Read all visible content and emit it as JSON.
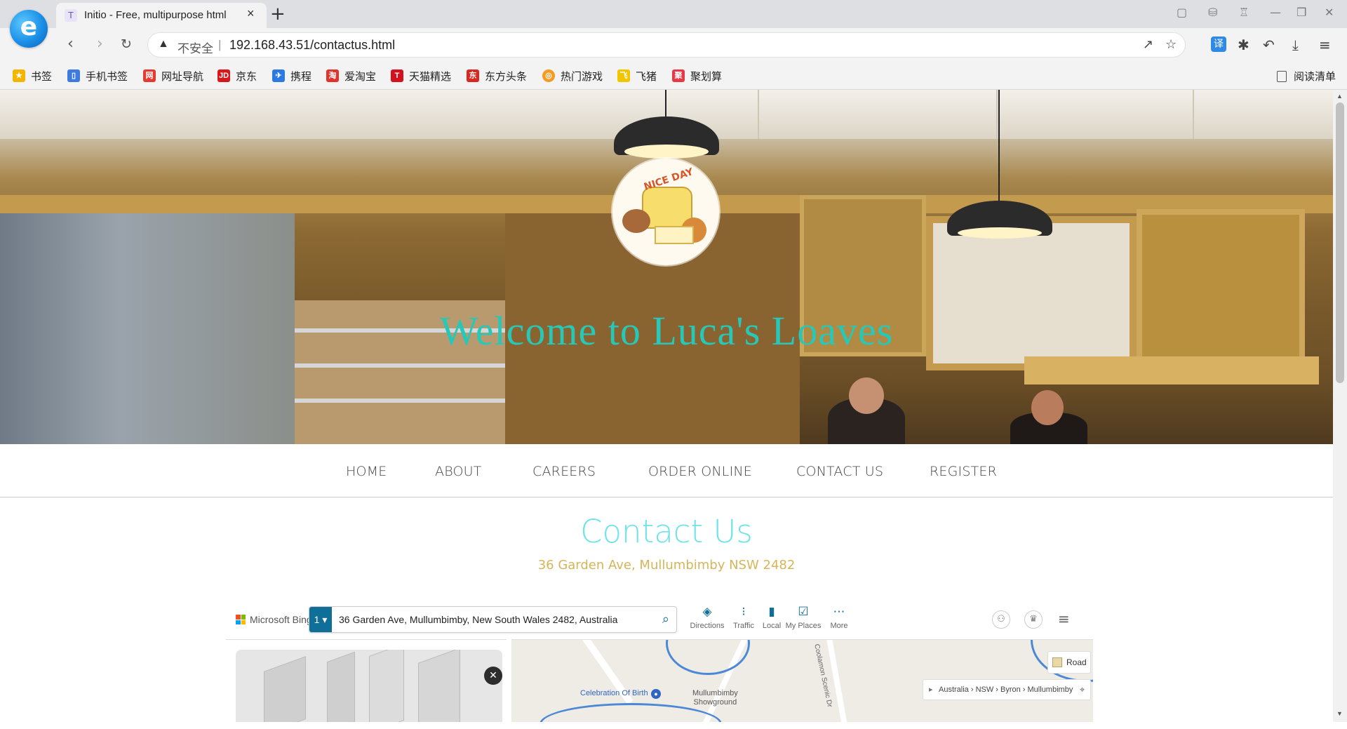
{
  "browser": {
    "tab": {
      "title": "Initio - Free, multipurpose html",
      "favicon": "T"
    },
    "new_tab_symbol": "+",
    "address": {
      "security_label": "不安全",
      "separator": "|",
      "url": "192.168.43.51/contactus.html"
    },
    "bookmarks": [
      {
        "label": "书签",
        "icon": "star-icon",
        "color": "#f5b400"
      },
      {
        "label": "手机书签",
        "icon": "phone-icon",
        "color": "#3d7be0"
      },
      {
        "label": "网址导航",
        "icon": "nav-icon",
        "color": "#e33b2f"
      },
      {
        "label": "京东",
        "icon": "jd-icon",
        "color": "#d8161b"
      },
      {
        "label": "携程",
        "icon": "ctrip-icon",
        "color": "#2a7ae2"
      },
      {
        "label": "爱淘宝",
        "icon": "taobao-icon",
        "color": "#e3322a"
      },
      {
        "label": "天猫精选",
        "icon": "tmall-icon",
        "color": "#d4121e"
      },
      {
        "label": "东方头条",
        "icon": "toutiao-icon",
        "color": "#d8281f"
      },
      {
        "label": "热门游戏",
        "icon": "game-icon",
        "color": "#f59a23"
      },
      {
        "label": "飞猪",
        "icon": "fliggy-icon",
        "color": "#f3c400"
      },
      {
        "label": "聚划算",
        "icon": "juhuasuan-icon",
        "color": "#e63946"
      }
    ],
    "reading_list": "阅读清单"
  },
  "hero": {
    "logo_text": "NICE DAY",
    "title": "Welcome to Luca's Loaves"
  },
  "nav": {
    "items": [
      "HOME",
      "ABOUT",
      "CAREERS",
      "ORDER ONLINE",
      "CONTACT US",
      "REGISTER"
    ]
  },
  "contact": {
    "title": "Contact Us",
    "address": "36 Garden Ave, Mullumbimby NSW 2482"
  },
  "map": {
    "brand": "Microsoft Bing",
    "pin_number": "1",
    "query": "36 Garden Ave, Mullumbimby, New South Wales 2482, Australia",
    "tools": [
      {
        "label": "Directions",
        "icon": "directions-icon"
      },
      {
        "label": "Traffic",
        "icon": "traffic-icon"
      },
      {
        "label": "Local",
        "icon": "local-icon"
      },
      {
        "label": "My Places",
        "icon": "my-places-icon"
      },
      {
        "label": "More",
        "icon": "more-icon"
      }
    ],
    "poi_label": "Celebration Of Birth",
    "poi_label2_line1": "Mullumbimby",
    "poi_label2_line2": "Showground",
    "road_label": "Coolamon Scenic Dr",
    "road_button": "Road",
    "breadcrumb": "Australia › NSW › Byron › Mullumbimby"
  }
}
